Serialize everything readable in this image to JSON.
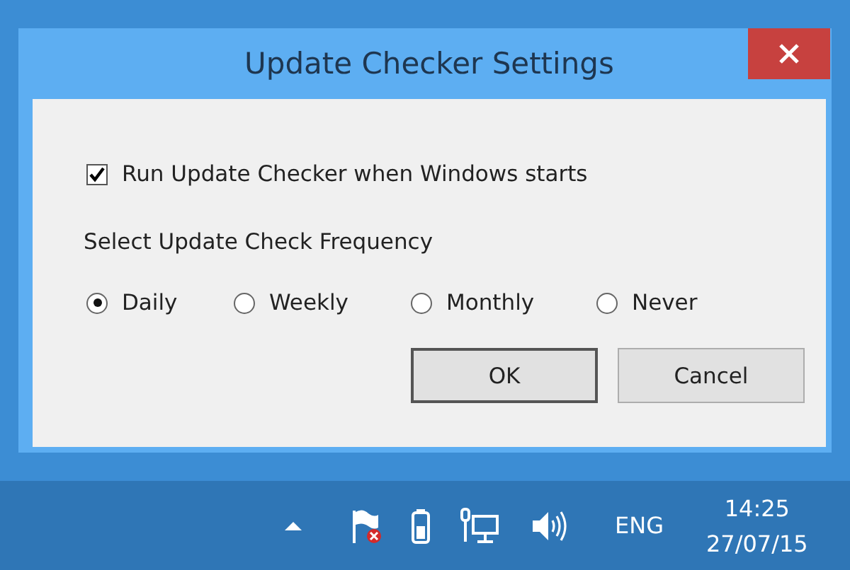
{
  "window": {
    "title": "Update Checker Settings"
  },
  "startup_option": {
    "label": "Run Update Checker when Windows starts",
    "checked": true
  },
  "frequency": {
    "label": "Select Update Check Frequency",
    "options": [
      {
        "label": "Daily",
        "selected": true
      },
      {
        "label": "Weekly",
        "selected": false
      },
      {
        "label": "Monthly",
        "selected": false
      },
      {
        "label": "Never",
        "selected": false
      }
    ]
  },
  "buttons": [
    "OK",
    "Cancel"
  ],
  "taskbar": {
    "language": "ENG",
    "time": "14:25",
    "date": "27/07/15"
  }
}
